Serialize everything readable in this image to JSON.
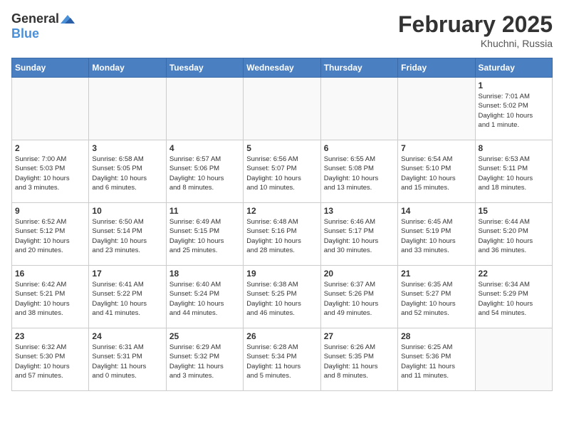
{
  "header": {
    "logo_general": "General",
    "logo_blue": "Blue",
    "title": "February 2025",
    "location": "Khuchni, Russia"
  },
  "days_of_week": [
    "Sunday",
    "Monday",
    "Tuesday",
    "Wednesday",
    "Thursday",
    "Friday",
    "Saturday"
  ],
  "weeks": [
    [
      {
        "day": "",
        "info": ""
      },
      {
        "day": "",
        "info": ""
      },
      {
        "day": "",
        "info": ""
      },
      {
        "day": "",
        "info": ""
      },
      {
        "day": "",
        "info": ""
      },
      {
        "day": "",
        "info": ""
      },
      {
        "day": "1",
        "info": "Sunrise: 7:01 AM\nSunset: 5:02 PM\nDaylight: 10 hours\nand 1 minute."
      }
    ],
    [
      {
        "day": "2",
        "info": "Sunrise: 7:00 AM\nSunset: 5:03 PM\nDaylight: 10 hours\nand 3 minutes."
      },
      {
        "day": "3",
        "info": "Sunrise: 6:58 AM\nSunset: 5:05 PM\nDaylight: 10 hours\nand 6 minutes."
      },
      {
        "day": "4",
        "info": "Sunrise: 6:57 AM\nSunset: 5:06 PM\nDaylight: 10 hours\nand 8 minutes."
      },
      {
        "day": "5",
        "info": "Sunrise: 6:56 AM\nSunset: 5:07 PM\nDaylight: 10 hours\nand 10 minutes."
      },
      {
        "day": "6",
        "info": "Sunrise: 6:55 AM\nSunset: 5:08 PM\nDaylight: 10 hours\nand 13 minutes."
      },
      {
        "day": "7",
        "info": "Sunrise: 6:54 AM\nSunset: 5:10 PM\nDaylight: 10 hours\nand 15 minutes."
      },
      {
        "day": "8",
        "info": "Sunrise: 6:53 AM\nSunset: 5:11 PM\nDaylight: 10 hours\nand 18 minutes."
      }
    ],
    [
      {
        "day": "9",
        "info": "Sunrise: 6:52 AM\nSunset: 5:12 PM\nDaylight: 10 hours\nand 20 minutes."
      },
      {
        "day": "10",
        "info": "Sunrise: 6:50 AM\nSunset: 5:14 PM\nDaylight: 10 hours\nand 23 minutes."
      },
      {
        "day": "11",
        "info": "Sunrise: 6:49 AM\nSunset: 5:15 PM\nDaylight: 10 hours\nand 25 minutes."
      },
      {
        "day": "12",
        "info": "Sunrise: 6:48 AM\nSunset: 5:16 PM\nDaylight: 10 hours\nand 28 minutes."
      },
      {
        "day": "13",
        "info": "Sunrise: 6:46 AM\nSunset: 5:17 PM\nDaylight: 10 hours\nand 30 minutes."
      },
      {
        "day": "14",
        "info": "Sunrise: 6:45 AM\nSunset: 5:19 PM\nDaylight: 10 hours\nand 33 minutes."
      },
      {
        "day": "15",
        "info": "Sunrise: 6:44 AM\nSunset: 5:20 PM\nDaylight: 10 hours\nand 36 minutes."
      }
    ],
    [
      {
        "day": "16",
        "info": "Sunrise: 6:42 AM\nSunset: 5:21 PM\nDaylight: 10 hours\nand 38 minutes."
      },
      {
        "day": "17",
        "info": "Sunrise: 6:41 AM\nSunset: 5:22 PM\nDaylight: 10 hours\nand 41 minutes."
      },
      {
        "day": "18",
        "info": "Sunrise: 6:40 AM\nSunset: 5:24 PM\nDaylight: 10 hours\nand 44 minutes."
      },
      {
        "day": "19",
        "info": "Sunrise: 6:38 AM\nSunset: 5:25 PM\nDaylight: 10 hours\nand 46 minutes."
      },
      {
        "day": "20",
        "info": "Sunrise: 6:37 AM\nSunset: 5:26 PM\nDaylight: 10 hours\nand 49 minutes."
      },
      {
        "day": "21",
        "info": "Sunrise: 6:35 AM\nSunset: 5:27 PM\nDaylight: 10 hours\nand 52 minutes."
      },
      {
        "day": "22",
        "info": "Sunrise: 6:34 AM\nSunset: 5:29 PM\nDaylight: 10 hours\nand 54 minutes."
      }
    ],
    [
      {
        "day": "23",
        "info": "Sunrise: 6:32 AM\nSunset: 5:30 PM\nDaylight: 10 hours\nand 57 minutes."
      },
      {
        "day": "24",
        "info": "Sunrise: 6:31 AM\nSunset: 5:31 PM\nDaylight: 11 hours\nand 0 minutes."
      },
      {
        "day": "25",
        "info": "Sunrise: 6:29 AM\nSunset: 5:32 PM\nDaylight: 11 hours\nand 3 minutes."
      },
      {
        "day": "26",
        "info": "Sunrise: 6:28 AM\nSunset: 5:34 PM\nDaylight: 11 hours\nand 5 minutes."
      },
      {
        "day": "27",
        "info": "Sunrise: 6:26 AM\nSunset: 5:35 PM\nDaylight: 11 hours\nand 8 minutes."
      },
      {
        "day": "28",
        "info": "Sunrise: 6:25 AM\nSunset: 5:36 PM\nDaylight: 11 hours\nand 11 minutes."
      },
      {
        "day": "",
        "info": ""
      }
    ]
  ]
}
